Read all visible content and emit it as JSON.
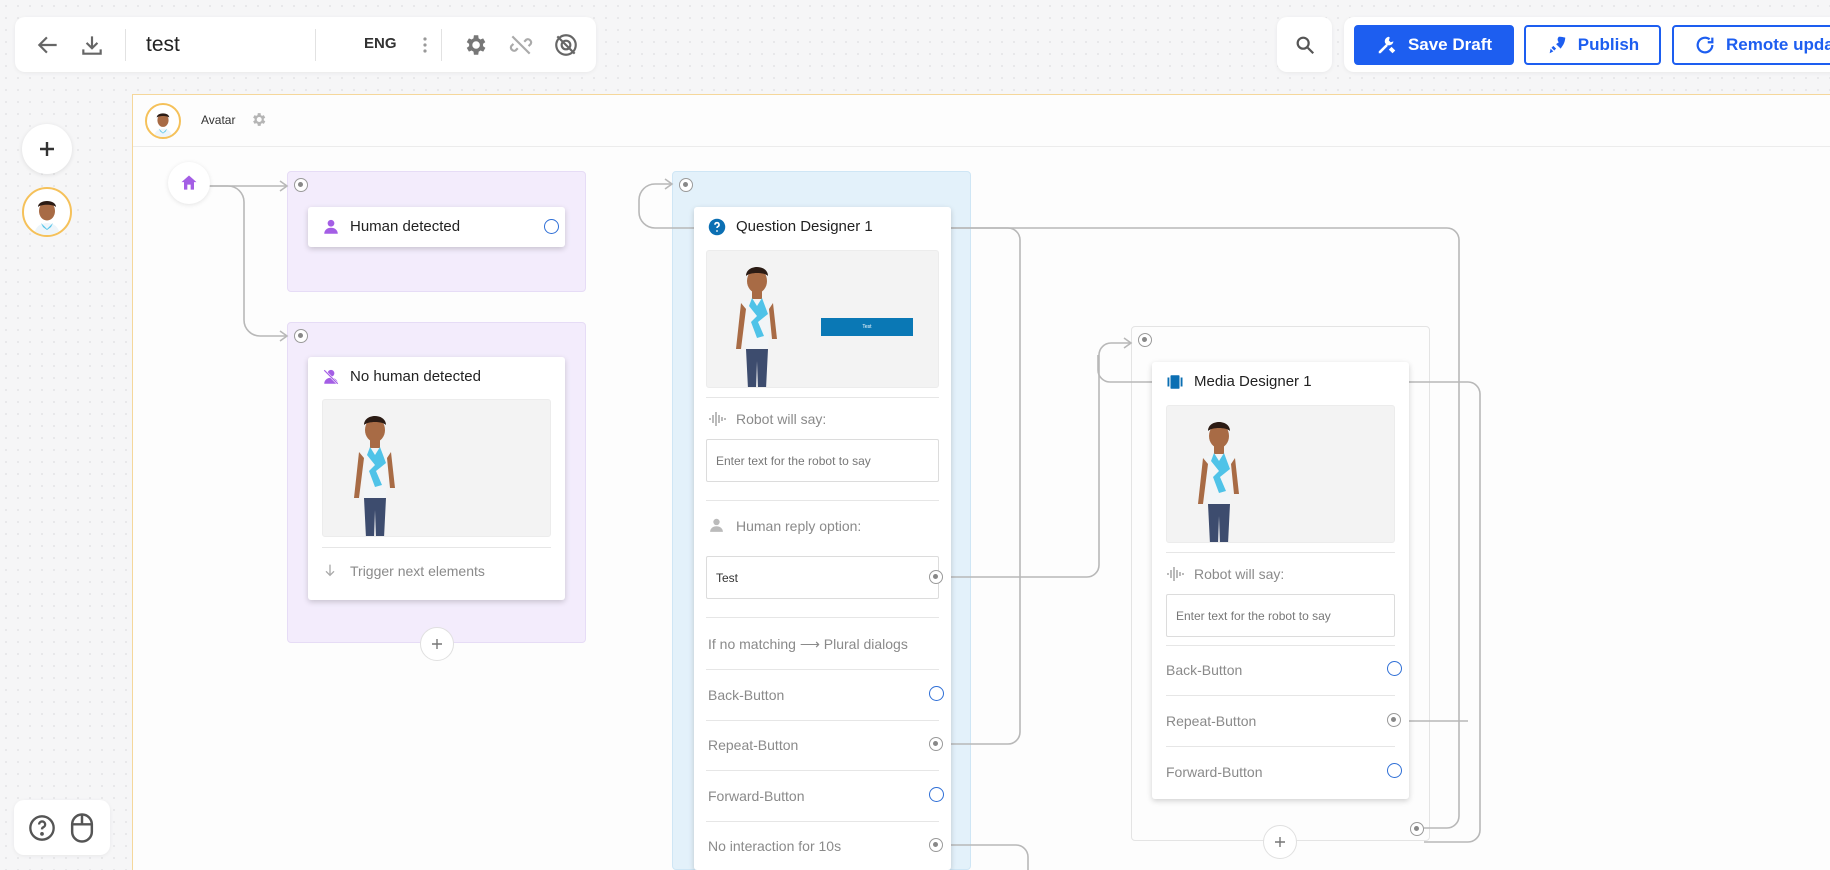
{
  "toolbar": {
    "project_name": "test",
    "language": "ENG"
  },
  "actions": {
    "save_draft": "Save Draft",
    "publish": "Publish",
    "remote_update": "Remote upda"
  },
  "canvas_header": {
    "avatar_label": "Avatar"
  },
  "nodes": {
    "human_detected": {
      "title": "Human detected"
    },
    "no_human_detected": {
      "title": "No human detected",
      "trigger": "Trigger next elements"
    },
    "question_designer": {
      "title": "Question Designer 1",
      "preview_button_label": "Test",
      "robot_will_say": "Robot will say:",
      "robot_say_placeholder": "Enter text for the robot to say",
      "human_reply_option": "Human reply option:",
      "reply_value": "Test",
      "no_match": "If no matching ⟶ Plural dialogs",
      "back_button": "Back-Button",
      "repeat_button": "Repeat-Button",
      "forward_button": "Forward-Button",
      "no_interaction": "No interaction for 10s"
    },
    "media_designer": {
      "title": "Media Designer 1",
      "robot_will_say": "Robot will say:",
      "robot_say_placeholder": "Enter text for the robot to say",
      "back_button": "Back-Button",
      "repeat_button": "Repeat-Button",
      "forward_button": "Forward-Button"
    }
  },
  "colors": {
    "primary": "#1d5ef0",
    "purple_group": "#f3ecfc",
    "blue_group": "#e3f1fa",
    "canvas_border": "#f5d79b"
  }
}
